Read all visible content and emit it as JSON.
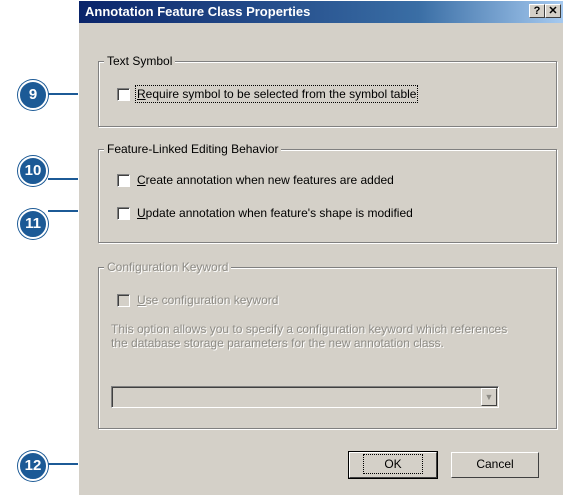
{
  "window": {
    "title": "Annotation Feature Class Properties",
    "help_btn": "?",
    "close_btn": "✕"
  },
  "text_symbol": {
    "legend": "Text Symbol",
    "require_symbol": {
      "label": "Require symbol to be selected from the symbol table",
      "checked": false
    }
  },
  "feature_linked": {
    "legend": "Feature-Linked Editing Behavior",
    "create_annotation": {
      "label": "Create annotation when new features are added",
      "checked": false
    },
    "update_annotation": {
      "label": "Update annotation when feature's shape is modified",
      "checked": false
    }
  },
  "config_keyword": {
    "legend": "Configuration Keyword",
    "use_keyword": {
      "label": "Use configuration keyword",
      "checked": false,
      "enabled": false
    },
    "description": "This option allows you to specify a configuration keyword which references the database storage parameters for the new annotation class.",
    "select_value": ""
  },
  "buttons": {
    "ok": "OK",
    "cancel": "Cancel"
  },
  "callouts": [
    "9",
    "10",
    "11",
    "12"
  ],
  "colors": {
    "callout": "#1c5a96",
    "title_start": "#0a246a",
    "dialog_face": "#d4d0c8"
  }
}
